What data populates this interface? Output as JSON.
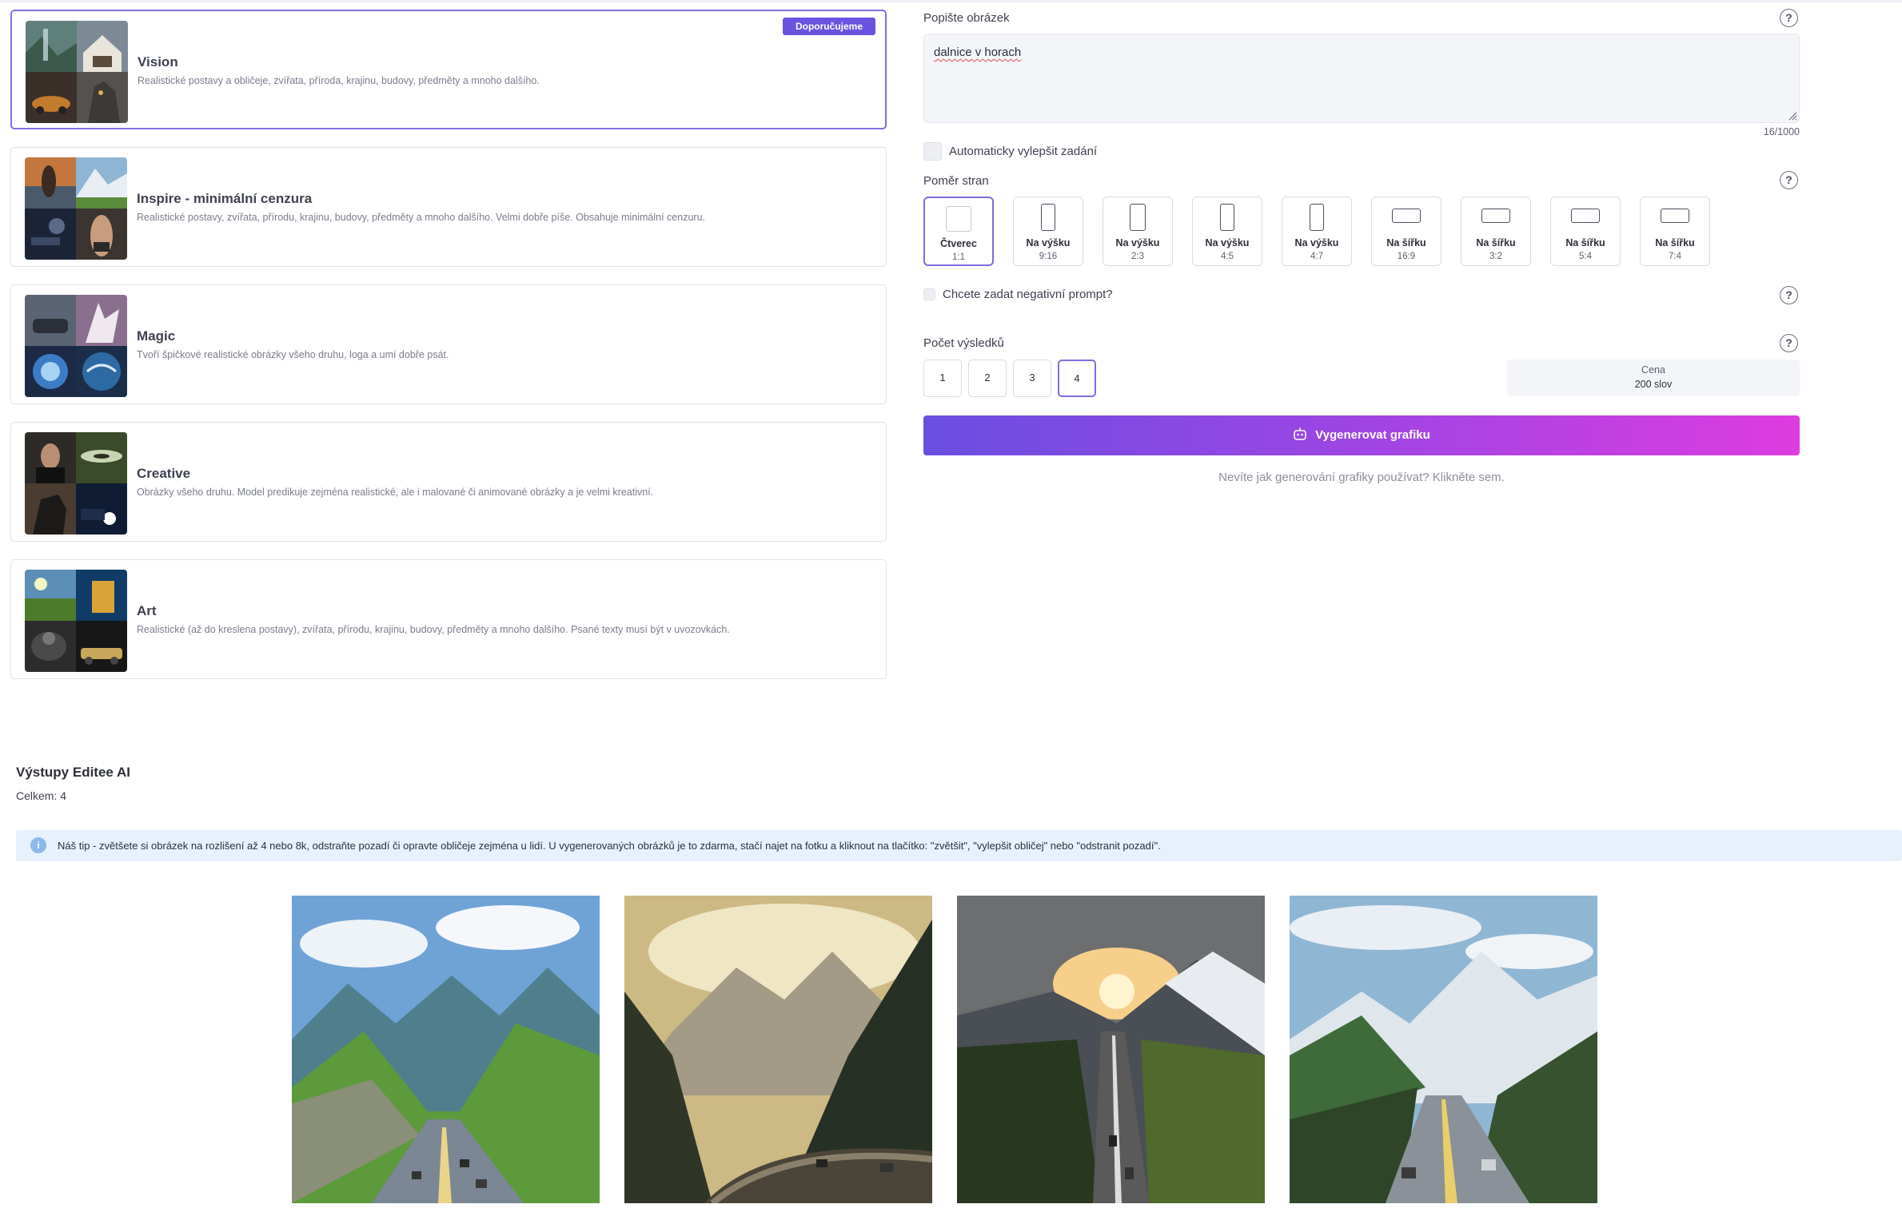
{
  "models": [
    {
      "title": "Vision",
      "description": "Realistické postavy a obličeje, zvířata, příroda, krajinu, budovy, předměty a mnoho dalšího.",
      "badge": "Doporučujeme",
      "selected": true
    },
    {
      "title": "Inspire - minimální cenzura",
      "description": "Realistické postavy, zvířata, přírodu, krajinu, budovy, předměty a mnoho dalšího. Velmi dobře píše. Obsahuje minimální cenzuru.",
      "selected": false
    },
    {
      "title": "Magic",
      "description": "Tvoří špičkové realistické obrázky všeho druhu, loga a umí dobře psát.",
      "selected": false
    },
    {
      "title": "Creative",
      "description": "Obrázky všeho druhu. Model predikuje zejména realistické, ale i malované či animované obrázky a je velmi kreativní.",
      "selected": false
    },
    {
      "title": "Art",
      "description": "Realistické (až do kreslena postavy), zvířata, přírodu, krajinu, budovy, předměty a mnoho dalšího. Psané texty musí být v uvozovkách.",
      "selected": false
    }
  ],
  "prompt": {
    "label": "Popište obrázek",
    "value": "dalnice v horach",
    "counter": "16/1000"
  },
  "auto_improve": {
    "label": "Automaticky vylepšit zadání",
    "checked": false
  },
  "aspect": {
    "label": "Poměr stran",
    "options": [
      {
        "name": "Čtverec",
        "ratio": "1:1",
        "selected": true
      },
      {
        "name": "Na výšku",
        "ratio": "9:16",
        "selected": false
      },
      {
        "name": "Na výšku",
        "ratio": "2:3",
        "selected": false
      },
      {
        "name": "Na výšku",
        "ratio": "4:5",
        "selected": false
      },
      {
        "name": "Na výšku",
        "ratio": "4:7",
        "selected": false
      },
      {
        "name": "Na šířku",
        "ratio": "16:9",
        "selected": false
      },
      {
        "name": "Na šířku",
        "ratio": "3:2",
        "selected": false
      },
      {
        "name": "Na šířku",
        "ratio": "5:4",
        "selected": false
      },
      {
        "name": "Na šířku",
        "ratio": "7:4",
        "selected": false
      }
    ]
  },
  "negative": {
    "label": "Chcete zadat negativní prompt?",
    "checked": false
  },
  "results_count": {
    "label": "Počet výsledků",
    "options": [
      "1",
      "2",
      "3",
      "4"
    ],
    "selected": "4"
  },
  "price": {
    "label": "Cena",
    "value": "200 slov"
  },
  "generate_button": "Vygenerovat grafiku",
  "help_link": "Nevíte jak generování grafiky používat? Klikněte sem.",
  "outputs": {
    "title": "Výstupy Editee AI",
    "total": "Celkem: 4",
    "tip": "Náš tip - zvětšete si obrázek na rozlišení až 4 nebo 8k, odstraňte pozadí či opravte obličeje zejména u lidí. U vygenerovaných obrázků je to zdarma, stačí najet na fotku a kliknout na tlačítko: \"zvětšit\", \"vylepšit obličej\" nebo \"odstranit pozadí\"."
  },
  "help_icon": "?",
  "info_icon": "i",
  "accent_color": "#6b52e0"
}
